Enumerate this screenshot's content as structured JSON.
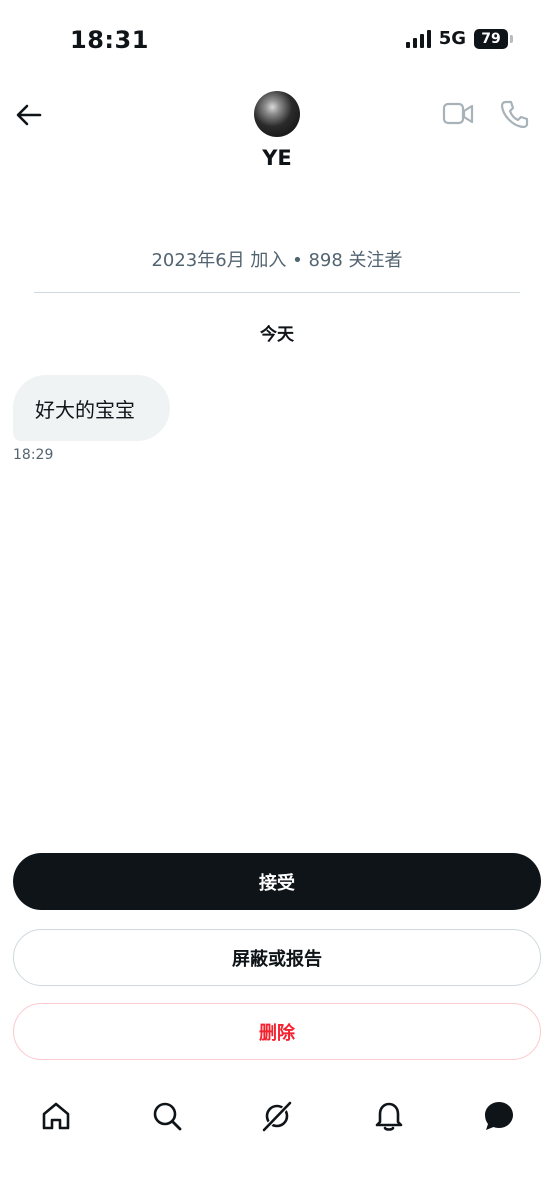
{
  "status_bar": {
    "time": "18:31",
    "network": "5G",
    "battery": "79",
    "icons": [
      "cellular-signal-icon",
      "battery-icon"
    ]
  },
  "header": {
    "contact_name": "YE",
    "icons": [
      "back-arrow-icon",
      "video-call-icon",
      "phone-call-icon"
    ]
  },
  "profile_meta": {
    "text": "2023年6月 加入 • 898 关注者"
  },
  "conversation": {
    "day_label": "今天",
    "messages": [
      {
        "text": "好大的宝宝",
        "time": "18:29"
      }
    ]
  },
  "actions": {
    "accept_label": "接受",
    "block_label": "屏蔽或报告",
    "delete_label": "删除"
  },
  "tab_bar": {
    "items": [
      "home-icon",
      "search-icon",
      "grok-icon",
      "notifications-bell-icon",
      "messages-icon"
    ]
  },
  "colors": {
    "text_primary": "#0f1419",
    "text_secondary": "#536471",
    "bubble_bg": "#eff3f4",
    "danger": "#f4212e",
    "border": "#cfd9de"
  }
}
